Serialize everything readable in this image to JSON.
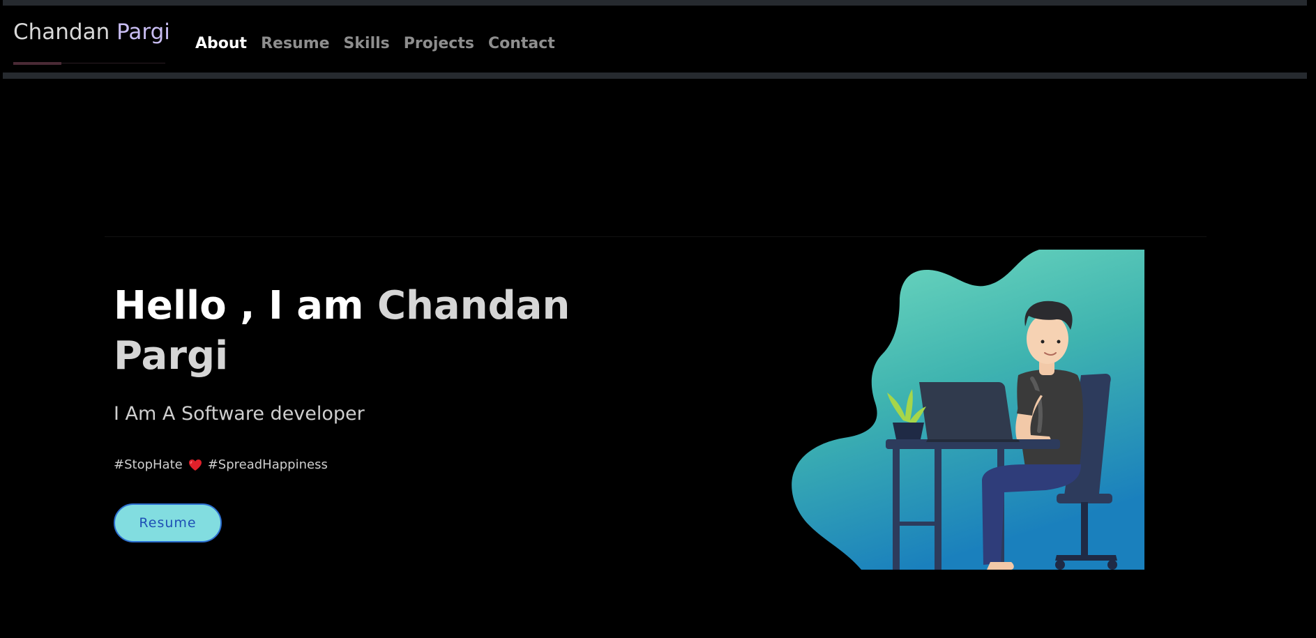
{
  "brand": {
    "first": "Chandan",
    "last": "Pargi"
  },
  "nav": {
    "items": [
      {
        "label": "About",
        "active": true
      },
      {
        "label": "Resume",
        "active": false
      },
      {
        "label": "Skills",
        "active": false
      },
      {
        "label": "Projects",
        "active": false
      },
      {
        "label": "Contact",
        "active": false
      }
    ]
  },
  "hero": {
    "greeting": "Hello , I am ",
    "name_first": "Chandan",
    "name_last": "Pargi",
    "subtitle": "I Am A Software developer",
    "hashtag_1": "#StopHate",
    "hashtag_2": "#SpreadHappiness",
    "resume_button": "Resume"
  },
  "colors": {
    "background": "#000000",
    "bar": "#262a2f",
    "brand_accent": "#c8bdf2",
    "button_bg": "#82dde0",
    "button_border": "#2d6fd0",
    "button_text": "#1d4fb5",
    "illustration_teal": "#6fd9bf",
    "illustration_blue": "#1b7fbf"
  }
}
